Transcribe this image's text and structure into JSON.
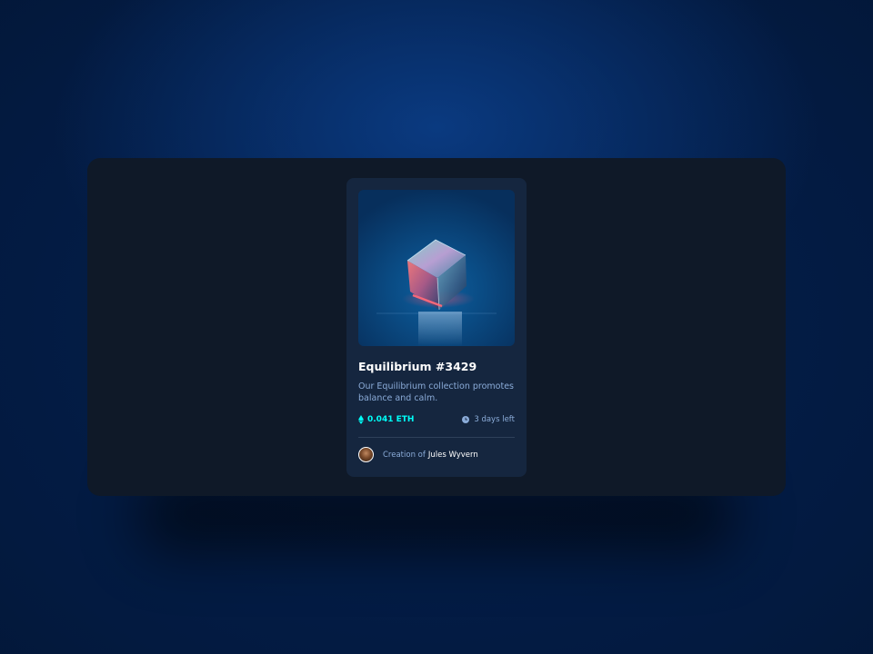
{
  "card": {
    "image_alt": "Equilibrium cube image",
    "title": "Equilibrium #3429",
    "description": "Our Equilibrium collection promotes balance and calm.",
    "price": "0.041 ETH",
    "time_left": "3 days left",
    "creator_prefix": "Creation of",
    "creator_name": "Jules Wyvern"
  },
  "icons": {
    "price": "ethereum-icon",
    "time": "clock-icon",
    "avatar": "avatar"
  },
  "colors": {
    "background": "#031a40",
    "panel": "#0f1928",
    "card": "#15263f",
    "accent_cyan": "#00fff8",
    "soft_blue": "#8bacd9",
    "white": "#ffffff",
    "divider": "#2e405a"
  }
}
